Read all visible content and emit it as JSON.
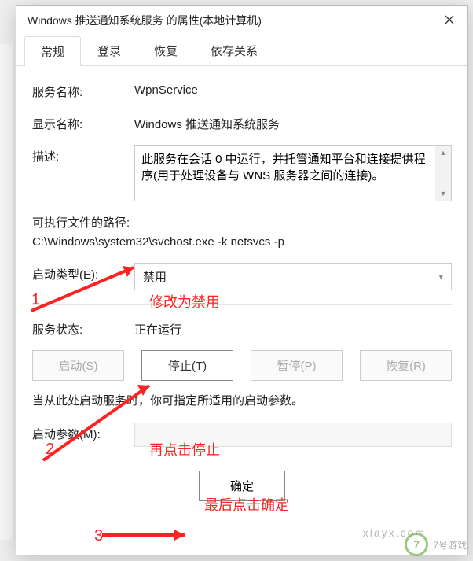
{
  "titlebar": {
    "title": "Windows 推送通知系统服务 的属性(本地计算机)"
  },
  "tabs": [
    "常规",
    "登录",
    "恢复",
    "依存关系"
  ],
  "active_tab": 0,
  "fields": {
    "service_name_label": "服务名称:",
    "service_name": "WpnService",
    "display_name_label": "显示名称:",
    "display_name": "Windows 推送通知系统服务",
    "description_label": "描述:",
    "description": "此服务在会话 0 中运行，并托管通知平台和连接提供程序(用于处理设备与 WNS 服务器之间的连接)。",
    "exe_path_label": "可执行文件的路径:",
    "exe_path": "C:\\Windows\\system32\\svchost.exe -k netsvcs -p",
    "startup_type_label": "启动类型(E):",
    "startup_type": "禁用",
    "service_status_label": "服务状态:",
    "service_status": "正在运行",
    "note": "当从此处启动服务时，你可指定所适用的启动参数。",
    "start_params_label": "启动参数(M):",
    "start_params": ""
  },
  "buttons": {
    "start": "启动(S)",
    "stop": "停止(T)",
    "pause": "暂停(P)",
    "resume": "恢复(R)",
    "ok": "确定"
  },
  "annotations": {
    "num1": "1",
    "text1": "修改为禁用",
    "num2": "2",
    "text2": "再点击停止",
    "num3": "3",
    "text3": "最后点击确定"
  },
  "watermark": {
    "brand": "7号游戏",
    "url": "xiayx.com"
  }
}
